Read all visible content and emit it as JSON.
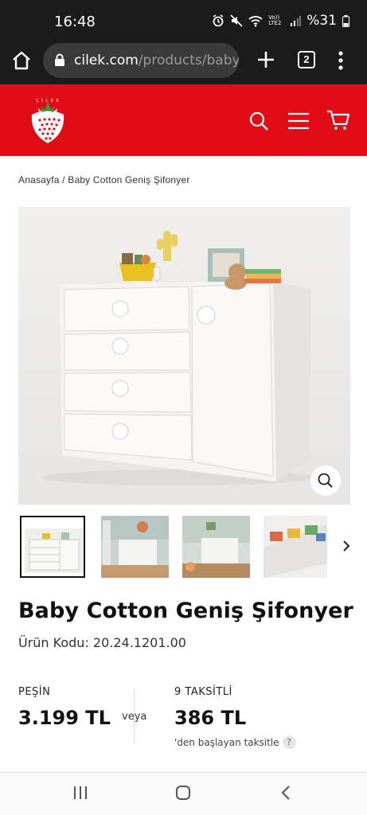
{
  "status_bar": {
    "time": "16:48",
    "network": "Vo))\nLTE2",
    "battery": "%31"
  },
  "browser": {
    "url_host": "cilek.com",
    "url_path": "/products/baby-co",
    "tab_count": "2"
  },
  "header": {
    "brand_color": "#e10c16",
    "icons": [
      "search-icon",
      "menu-icon",
      "cart-icon"
    ]
  },
  "breadcrumb": "Anasayfa / Baby Cotton Geniş Şifonyer",
  "product": {
    "title": "Baby Cotton Geniş Şifonyer",
    "code": "Ürün Kodu: 20.24.1201.00"
  },
  "pricing": {
    "cash_label": "PEŞİN",
    "cash_price": "3.199 TL",
    "or_label": "veya",
    "installment_label": "9 TAKSİTLİ",
    "installment_price": "386 TL",
    "installment_note": "'den başlayan taksitle",
    "help": "?"
  }
}
